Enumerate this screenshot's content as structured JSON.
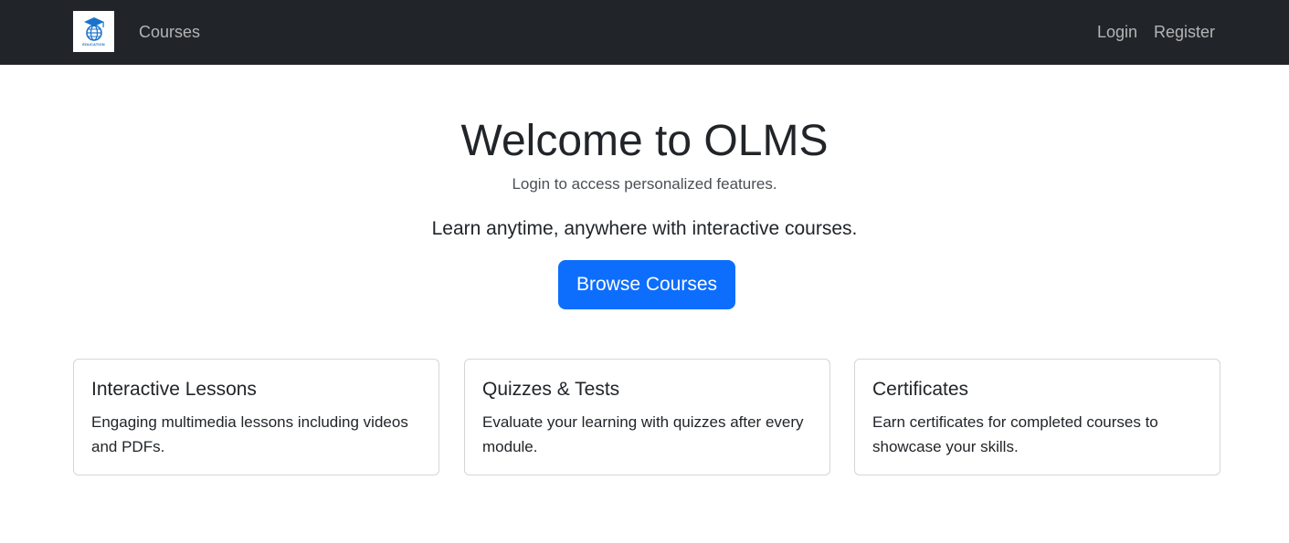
{
  "navbar": {
    "logo_text": "EDUCATION",
    "links": {
      "courses": "Courses",
      "login": "Login",
      "register": "Register"
    }
  },
  "hero": {
    "title": "Welcome to OLMS",
    "note": "Login to access personalized features.",
    "lead": "Learn anytime, anywhere with interactive courses.",
    "button_label": "Browse Courses"
  },
  "features": [
    {
      "title": "Interactive Lessons",
      "text": "Engaging multimedia lessons including videos and PDFs."
    },
    {
      "title": "Quizzes & Tests",
      "text": "Evaluate your learning with quizzes after every module."
    },
    {
      "title": "Certificates",
      "text": "Earn certificates for completed courses to showcase your skills."
    }
  ],
  "colors": {
    "navbar_bg": "#212529",
    "primary": "#0d6efd",
    "logo_blue": "#1a73c9"
  },
  "icons": {
    "logo": "globe-graduation-cap-icon"
  }
}
